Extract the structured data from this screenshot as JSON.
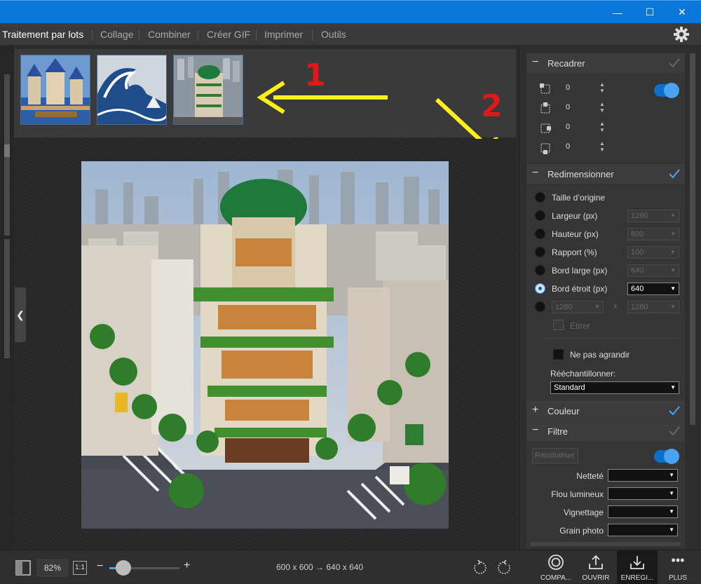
{
  "window": {
    "minimize": "—",
    "maximize": "☐",
    "close": "✕"
  },
  "menu": {
    "items": [
      "Traitement par lots",
      "Collage",
      "Combiner",
      "Créer GIF",
      "Imprimer",
      "Outils"
    ]
  },
  "annotations": {
    "arrow1": "1",
    "arrow2": "2"
  },
  "panel": {
    "recadrer": {
      "sign": "−",
      "title": "Recadrer",
      "values": [
        "0",
        "0",
        "0",
        "0"
      ]
    },
    "redimensionner": {
      "sign": "−",
      "title": "Redimensionner",
      "options": [
        {
          "label": "Taille d’origine"
        },
        {
          "label": "Largeur (px)",
          "value": "1280"
        },
        {
          "label": "Hauteur (px)",
          "value": "800"
        },
        {
          "label": "Rapport (%)",
          "value": "100"
        },
        {
          "label": "Bord large (px)",
          "value": "640"
        },
        {
          "label": "Bord étroit (px)",
          "value": "640"
        }
      ],
      "custom_w": "1280",
      "custom_x": "x",
      "custom_h": "1280",
      "etirer": "Étirer",
      "ne_pas_agrandir": "Ne pas agrandir",
      "reechantillonner_label": "Rééchantillonner:",
      "reechantillonner_value": "Standard"
    },
    "couleur": {
      "sign": "+",
      "title": "Couleur"
    },
    "filtre": {
      "sign": "−",
      "title": "Filtre",
      "reset": "Réinitialiser",
      "labels": [
        "Netteté",
        "Flou lumineux",
        "Vignettage",
        "Grain photo"
      ]
    }
  },
  "bottom": {
    "zoom": "82%",
    "one_to_one": "1:1",
    "minus": "−",
    "plus": "+",
    "zoom_level": 0.2,
    "dimensions": "600 x 600 → 640 x 640",
    "buttons": [
      "COMPA...",
      "OUVRIR",
      "ENREGI...",
      "PLUS"
    ]
  },
  "colors": {
    "titlebar": "#0b77d8",
    "accent": "#4aa3f0",
    "annotation_arrow": "#ffef1a",
    "annotation_number": "#e01818"
  }
}
